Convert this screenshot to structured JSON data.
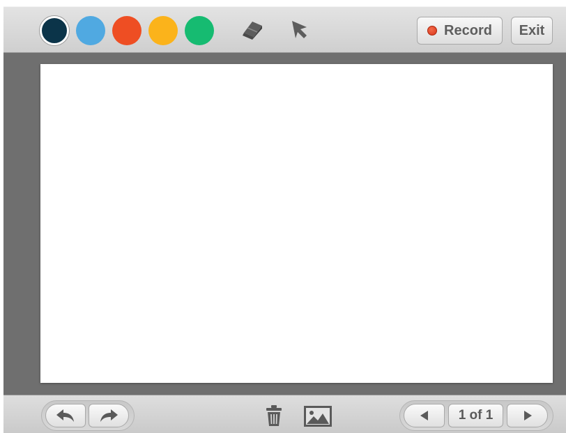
{
  "palette": {
    "colors": [
      {
        "name": "navy",
        "hex": "#0b3449",
        "selected": true
      },
      {
        "name": "blue",
        "hex": "#50a9e1",
        "selected": false
      },
      {
        "name": "red",
        "hex": "#ee4e23",
        "selected": false
      },
      {
        "name": "orange",
        "hex": "#fbb31b",
        "selected": false
      },
      {
        "name": "green",
        "hex": "#16bb71",
        "selected": false
      }
    ]
  },
  "tools": {
    "eraser_icon": "eraser-icon",
    "pointer_icon": "pointer-icon"
  },
  "toolbar": {
    "record_label": "Record",
    "exit_label": "Exit",
    "record_dot_color": "#e2431f"
  },
  "bottom_bar": {
    "undo_icon": "undo-icon",
    "redo_icon": "redo-icon",
    "trash_icon": "trash-icon",
    "image_icon": "image-icon",
    "prev_icon": "prev-page-icon",
    "next_icon": "next-page-icon",
    "page_indicator": "1 of 1"
  },
  "colors": {
    "toolbar_bg": "#d6d6d6",
    "workspace_bg": "#6f6f6f",
    "canvas_bg": "#ffffff",
    "icon_gray": "#5d5d5d"
  }
}
